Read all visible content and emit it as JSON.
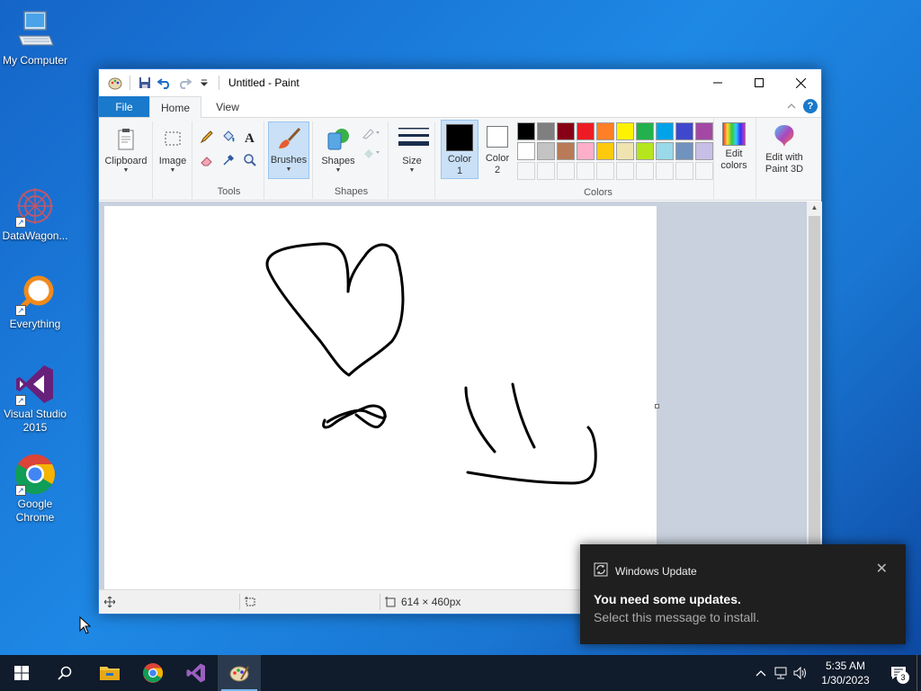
{
  "desktop": {
    "icons": [
      {
        "label": "My Computer"
      },
      {
        "label": "DataWagon..."
      },
      {
        "label": "Everything"
      },
      {
        "label": "Visual Studio 2015"
      },
      {
        "label": "Google Chrome"
      }
    ]
  },
  "window": {
    "title": "Untitled - Paint",
    "tabs": {
      "file": "File",
      "home": "Home",
      "view": "View"
    },
    "ribbon": {
      "clipboard": "Clipboard",
      "image": "Image",
      "tools": "Tools",
      "brushes": "Brushes",
      "shapes_btn": "Shapes",
      "shapes_group": "Shapes",
      "size": "Size",
      "color1": "Color\n1",
      "color2": "Color\n2",
      "colors_group": "Colors",
      "edit_colors": "Edit\ncolors",
      "edit_paint3d": "Edit with\nPaint 3D",
      "palette": [
        "#000000",
        "#7f7f7f",
        "#880015",
        "#ed1c24",
        "#ff7f27",
        "#fff200",
        "#22b14c",
        "#00a2e8",
        "#3f48cc",
        "#a349a4",
        "#ffffff",
        "#c3c3c3",
        "#b97a57",
        "#ffaec9",
        "#ffc90e",
        "#efe4b0",
        "#b5e61d",
        "#99d9ea",
        "#7092be",
        "#c8bfe7"
      ]
    },
    "status": {
      "size": "614 × 460px"
    }
  },
  "toast": {
    "app": "Windows Update",
    "message": "You need some updates.",
    "sub": "Select this message to install."
  },
  "taskbar": {
    "time": "5:35 AM",
    "date": "1/30/2023",
    "notifications": "3"
  },
  "colors": {
    "accent": "#1979ca",
    "taskbar": "#101b2b"
  }
}
